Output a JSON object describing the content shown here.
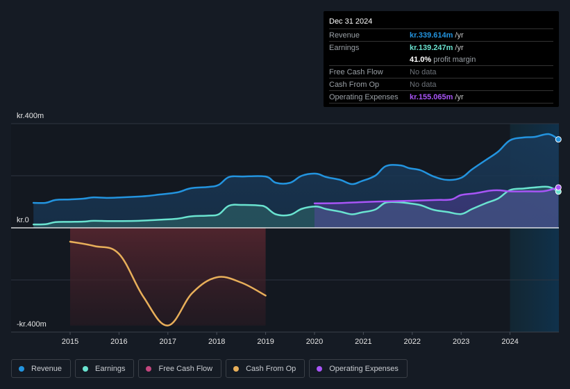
{
  "tooltip": {
    "date": "Dec 31 2024",
    "rows": [
      {
        "label": "Revenue",
        "value": "kr.339.614m",
        "unit": "/yr",
        "color": "#2394df"
      },
      {
        "label": "Earnings",
        "value": "kr.139.247m",
        "unit": "/yr",
        "color": "#6ae3d0"
      },
      {
        "label": "",
        "value": "41.0%",
        "unit": "profit margin",
        "color": "#ffffff"
      },
      {
        "label": "Free Cash Flow",
        "value": "No data",
        "unit": "",
        "color": "#6e737a"
      },
      {
        "label": "Cash From Op",
        "value": "No data",
        "unit": "",
        "color": "#6e737a"
      },
      {
        "label": "Operating Expenses",
        "value": "kr.155.065m",
        "unit": "/yr",
        "color": "#a855f7"
      }
    ]
  },
  "legend": [
    {
      "label": "Revenue",
      "color": "#2394df"
    },
    {
      "label": "Earnings",
      "color": "#6ae3d0"
    },
    {
      "label": "Free Cash Flow",
      "color": "#c2467e"
    },
    {
      "label": "Cash From Op",
      "color": "#e8af5a"
    },
    {
      "label": "Operating Expenses",
      "color": "#a855f7"
    }
  ],
  "chart_data": {
    "type": "area",
    "title": "",
    "xlabel": "",
    "ylabel": "",
    "y_unit": "kr. millions",
    "ylim": [
      -400,
      400
    ],
    "xlim": [
      2014.25,
      2025.0
    ],
    "y_tick_labels": [
      {
        "value": 400,
        "label": "kr.400m"
      },
      {
        "value": 0,
        "label": "kr.0"
      },
      {
        "value": -400,
        "label": "-kr.400m"
      }
    ],
    "x_ticks": [
      2015,
      2016,
      2017,
      2018,
      2019,
      2020,
      2021,
      2022,
      2023,
      2024
    ],
    "x_tick_labels": [
      "2015",
      "2016",
      "2017",
      "2018",
      "2019",
      "2020",
      "2021",
      "2022",
      "2023",
      "2024"
    ],
    "highlight_range": [
      2024.0,
      2025.0
    ],
    "grid": true,
    "series": [
      {
        "name": "Revenue",
        "color": "#2394df",
        "x": [
          2014.25,
          2014.5,
          2014.7,
          2015.0,
          2015.27,
          2015.48,
          2015.77,
          2016.06,
          2016.4,
          2016.62,
          2016.83,
          2017.19,
          2017.47,
          2017.83,
          2018.04,
          2018.25,
          2018.53,
          2019.0,
          2019.21,
          2019.5,
          2019.74,
          2020.03,
          2020.24,
          2020.53,
          2020.76,
          2020.96,
          2021.24,
          2021.46,
          2021.75,
          2021.94,
          2022.17,
          2022.44,
          2022.72,
          2023.0,
          2023.22,
          2023.51,
          2023.76,
          2024.0,
          2024.28,
          2024.5,
          2024.79,
          2024.99
        ],
        "values": [
          96,
          96,
          107,
          109,
          112,
          117,
          115,
          117,
          120,
          123,
          128,
          136,
          152,
          157,
          165,
          195,
          197,
          197,
          173,
          173,
          200,
          208,
          195,
          184,
          168,
          179,
          200,
          237,
          240,
          229,
          221,
          197,
          184,
          192,
          224,
          261,
          293,
          336,
          347,
          349,
          360,
          339.6
        ]
      },
      {
        "name": "Earnings",
        "color": "#6ae3d0",
        "x": [
          2014.25,
          2014.5,
          2014.7,
          2015.0,
          2015.27,
          2015.48,
          2015.77,
          2016.06,
          2016.4,
          2016.62,
          2016.83,
          2017.19,
          2017.47,
          2017.83,
          2018.04,
          2018.25,
          2018.53,
          2018.85,
          2019.0,
          2019.21,
          2019.5,
          2019.74,
          2020.03,
          2020.24,
          2020.53,
          2020.76,
          2020.96,
          2021.24,
          2021.46,
          2021.75,
          2021.94,
          2022.17,
          2022.44,
          2022.72,
          2023.0,
          2023.22,
          2023.51,
          2023.76,
          2024.0,
          2024.28,
          2024.5,
          2024.79,
          2024.99
        ],
        "values": [
          13,
          14,
          22,
          23,
          24,
          27,
          26,
          26,
          27,
          29,
          31,
          35,
          44,
          47,
          52,
          85,
          88,
          86,
          80,
          52,
          50,
          73,
          82,
          72,
          62,
          52,
          59,
          70,
          97,
          98,
          94,
          87,
          69,
          61,
          53,
          72,
          95,
          113,
          145,
          151,
          155,
          157,
          139.2
        ]
      },
      {
        "name": "Free Cash Flow",
        "color": "#c2467e",
        "x": [],
        "values": []
      },
      {
        "name": "Cash From Op",
        "color": "#e8af5a",
        "x": [
          2015.0,
          2015.5,
          2016.0,
          2016.5,
          2017.0,
          2017.5,
          2018.0,
          2018.5,
          2019.0
        ],
        "values": [
          -53,
          -70,
          -100,
          -265,
          -375,
          -250,
          -190,
          -210,
          -260
        ]
      },
      {
        "name": "Operating Expenses",
        "color": "#a855f7",
        "x": [
          2020.0,
          2020.5,
          2021.0,
          2021.5,
          2022.0,
          2022.5,
          2022.8,
          2023.0,
          2023.3,
          2023.6,
          2023.8,
          2024.0,
          2024.4,
          2024.7,
          2024.99
        ],
        "values": [
          94,
          95,
          99,
          102,
          104,
          107,
          109,
          126,
          133,
          143,
          144,
          140,
          140,
          141,
          155.1
        ]
      }
    ]
  }
}
